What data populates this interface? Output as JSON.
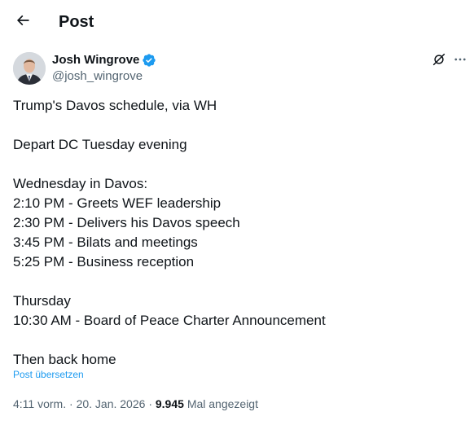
{
  "header": {
    "back_icon": "arrow-left-icon",
    "title": "Post"
  },
  "post": {
    "author": {
      "name": "Josh Wingrove",
      "handle": "@josh_wingrove",
      "verified_color": "#1d9bf0"
    },
    "text_lines": [
      "Trump's Davos schedule, via WH",
      "",
      "Depart DC Tuesday evening",
      "",
      "Wednesday in Davos:",
      "2:10 PM - Greets WEF leadership",
      "2:30 PM - Delivers his Davos speech",
      "3:45 PM - Bilats and meetings",
      "5:25 PM - Business reception",
      "",
      "Thursday",
      "10:30 AM - Board of Peace Charter Announcement",
      "",
      "Then back home"
    ],
    "translate_label": "Post übersetzen",
    "timestamp": "4:11 vorm.",
    "separator": "·",
    "date": "20. Jan. 2026",
    "views_count": "9.945",
    "views_label": "Mal angezeigt"
  },
  "colors": {
    "accent": "#1d9bf0",
    "text": "#0f1419",
    "secondary": "#536471"
  }
}
